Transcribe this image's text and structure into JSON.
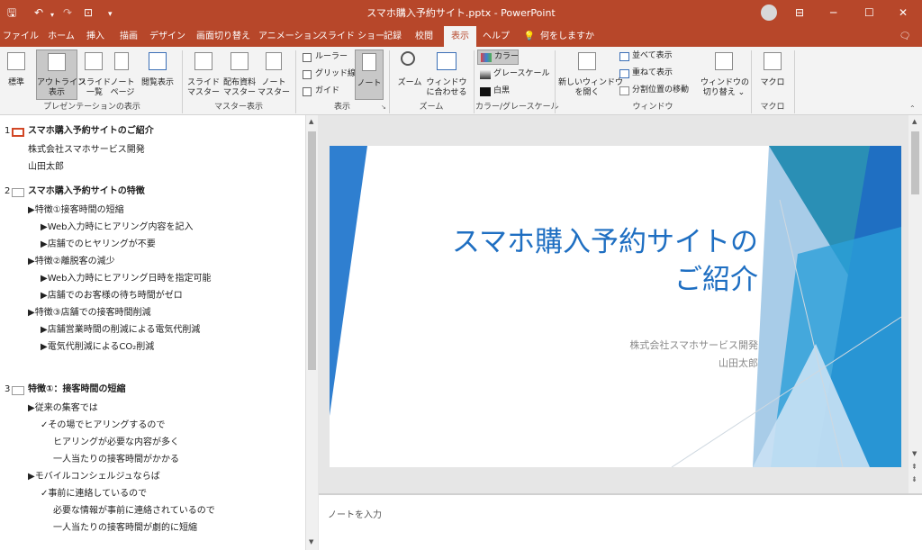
{
  "window": {
    "title": "スマホ購入予約サイト.pptx  -  PowerPoint",
    "controls": {
      "minimize": "─",
      "maximize": "☐",
      "close": "✕"
    }
  },
  "quick_access": {
    "save": "🖫",
    "undo": "↶",
    "redo": "↷",
    "customize": "▾"
  },
  "tabs": [
    "ファイル",
    "ホーム",
    "挿入",
    "描画",
    "デザイン",
    "画面切り替え",
    "アニメーション",
    "スライド ショー",
    "記録",
    "校閲",
    "表示",
    "ヘルプ"
  ],
  "active_tab": "表示",
  "tell_me": "何をしますか",
  "ribbon": {
    "groups": {
      "presentation_views": "プレゼンテーションの表示",
      "master_views": "マスター表示",
      "show": "表示",
      "zoom": "ズーム",
      "color": "カラー/グレースケール",
      "window": "ウィンドウ",
      "macros": "マクロ"
    },
    "buttons": {
      "normal": "標準",
      "outline_1": "アウトライン",
      "outline_2": "表示",
      "sorter_1": "スライド",
      "sorter_2": "一覧",
      "notes_page_1": "ノート",
      "notes_page_2": "ページ",
      "reading": "閲覧表示",
      "slide_master_1": "スライド",
      "slide_master_2": "マスター",
      "handout_master_1": "配布資料",
      "handout_master_2": "マスター",
      "notes_master_1": "ノート",
      "notes_master_2": "マスター",
      "ruler": "ルーラー",
      "gridlines": "グリッド線",
      "guides": "ガイド",
      "notes": "ノート",
      "zoom": "ズーム",
      "fit_1": "ウィンドウ",
      "fit_2": "に合わせる",
      "color": "カラー",
      "grayscale": "グレースケール",
      "bw": "白黒",
      "new_window_1": "新しいウィンドウ",
      "new_window_2": "を開く",
      "arrange_all": "並べて表示",
      "cascade": "重ねて表示",
      "move_split": "分割位置の移動",
      "switch_1": "ウィンドウの",
      "switch_2": "切り替え ⌄",
      "macros": "マクロ"
    }
  },
  "outline": {
    "slides": [
      {
        "num": "1",
        "title": "スマホ購入予約サイトのご紹介",
        "lines": [
          "株式会社スマホサービス開発",
          "山田太郎"
        ]
      },
      {
        "num": "2",
        "title": "スマホ購入予約サイトの特徴",
        "lines": [
          "▶特徴①接客時間の短縮",
          "▶Web入力時にヒアリング内容を記入",
          "▶店舗でのヒヤリングが不要",
          "▶特徴②離脱客の減少",
          "▶Web入力時にヒアリング日時を指定可能",
          "▶店舗でのお客様の待ち時間がゼロ",
          "▶特徴③店舗での接客時間削減",
          "▶店舗営業時間の削減による電気代削減",
          "▶電気代削減によるCO₂削減"
        ]
      },
      {
        "num": "3",
        "title": "特徴①：接客時間の短縮",
        "lines": [
          "▶従来の集客では",
          "✓その場でヒアリングするので",
          "ヒアリングが必要な内容が多く",
          "一人当たりの接客時間がかかる",
          "▶モバイルコンシェルジュならば",
          "✓事前に連絡しているので",
          "必要な情報が事前に連絡されているので",
          "一人当たりの接客時間が劇的に短縮"
        ]
      }
    ]
  },
  "slide": {
    "title_line1": "スマホ購入予約サイトの",
    "title_line2": "ご紹介",
    "subtitle_line1": "株式会社スマホサービス開発",
    "subtitle_line2": "山田太郎"
  },
  "notes_placeholder": "ノートを入力",
  "colors": {
    "accent": "#b7472a",
    "slide_title": "#1f6fc2"
  }
}
